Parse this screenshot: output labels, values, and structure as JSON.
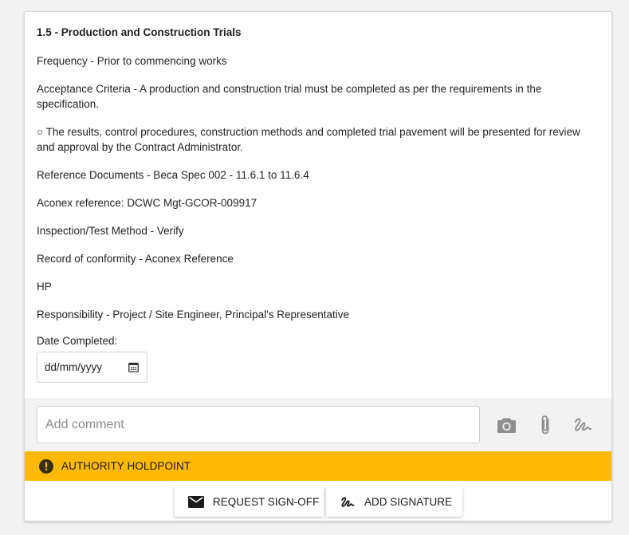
{
  "item": {
    "title": "1.5 - Production and Construction Trials",
    "lines": [
      "Frequency - Prior to commencing works",
      "Acceptance Criteria - A production and construction trial must be completed as per the requirements in the specification.",
      "○ The results, control procedures, construction methods and completed trial pavement will be presented for review and approval by the Contract Administrator.",
      "Reference Documents - Beca Spec 002 - 11.6.1 to 11.6.4",
      "Aconex reference: DCWC Mgt-GCOR-009917",
      "Inspection/Test Method - Verify",
      "Record of conformity - Aconex Reference",
      "HP",
      "Responsibility - Project / Site Engineer, Principal's Representative"
    ],
    "date_label": "Date Completed:",
    "date_placeholder": "dd/mm/yyyy"
  },
  "comment": {
    "placeholder": "Add comment",
    "icons": [
      "camera-icon",
      "paperclip-icon",
      "signature-icon"
    ]
  },
  "holdpoint": {
    "label": "AUTHORITY HOLDPOINT",
    "icon": "alert-circle-icon",
    "color": "#ffb900"
  },
  "actions": {
    "request_label": "REQUEST SIGN-OFF",
    "request_icon": "envelope-icon",
    "signature_label": "ADD SIGNATURE",
    "signature_icon": "signature-icon"
  }
}
